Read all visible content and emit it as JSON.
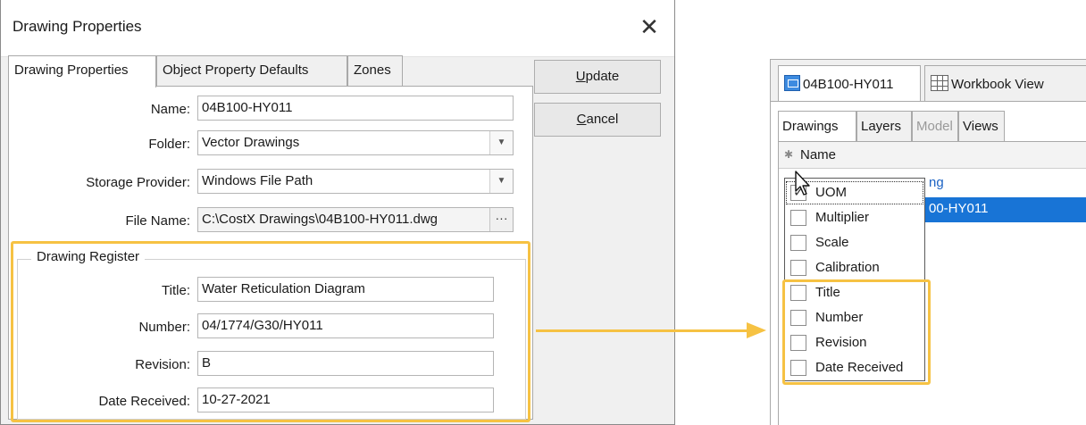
{
  "dialog": {
    "title": "Drawing Properties",
    "close_glyph": "✕",
    "tabs": [
      {
        "label": "Drawing Properties",
        "active": true
      },
      {
        "label": "Object Property Defaults",
        "active": false
      },
      {
        "label": "Zones",
        "active": false
      }
    ],
    "fields": {
      "name": {
        "label": "Name:",
        "value": "04B100-HY011"
      },
      "folder": {
        "label": "Folder:",
        "value": "Vector Drawings"
      },
      "storage_provider": {
        "label": "Storage Provider:",
        "value": "Windows File Path"
      },
      "file_name": {
        "label": "File Name:",
        "value": "C:\\CostX Drawings\\04B100-HY011.dwg",
        "button": "···"
      }
    },
    "drawing_register": {
      "group_title": "Drawing Register",
      "title": {
        "label": "Title:",
        "value": "Water Reticulation Diagram"
      },
      "number": {
        "label": "Number:",
        "value": "04/1774/G30/HY011"
      },
      "revision": {
        "label": "Revision:",
        "value": "B"
      },
      "date_received": {
        "label": "Date Received:",
        "value": "10-27-2021"
      }
    },
    "buttons": {
      "update": {
        "accel": "U",
        "rest": "pdate"
      },
      "cancel": {
        "accel": "C",
        "rest": "ancel"
      }
    }
  },
  "right_panel": {
    "doc_tabs": [
      {
        "label": "04B100-HY011",
        "icon": "drawing-icon",
        "active": true
      },
      {
        "label": "Workbook View",
        "icon": "grid-icon",
        "active": false
      }
    ],
    "sub_tabs": [
      {
        "label": "Drawings",
        "active": true,
        "disabled": false
      },
      {
        "label": "Layers",
        "active": false,
        "disabled": false
      },
      {
        "label": "Model",
        "active": false,
        "disabled": true
      },
      {
        "label": "Views",
        "active": false,
        "disabled": false
      }
    ],
    "grid": {
      "header_star": "✱",
      "header_name": "Name",
      "partial_link": "ng",
      "selected_row_partial": "00-HY011"
    },
    "column_chooser": [
      {
        "label": "UOM",
        "checked": true
      },
      {
        "label": "Multiplier",
        "checked": false
      },
      {
        "label": "Scale",
        "checked": false
      },
      {
        "label": "Calibration",
        "checked": false
      },
      {
        "label": "Title",
        "checked": false
      },
      {
        "label": "Number",
        "checked": false
      },
      {
        "label": "Revision",
        "checked": false
      },
      {
        "label": "Date Received",
        "checked": false
      }
    ]
  },
  "colors": {
    "highlight": "#f6c243",
    "selection": "#1874d6",
    "link": "#1b62c4"
  }
}
